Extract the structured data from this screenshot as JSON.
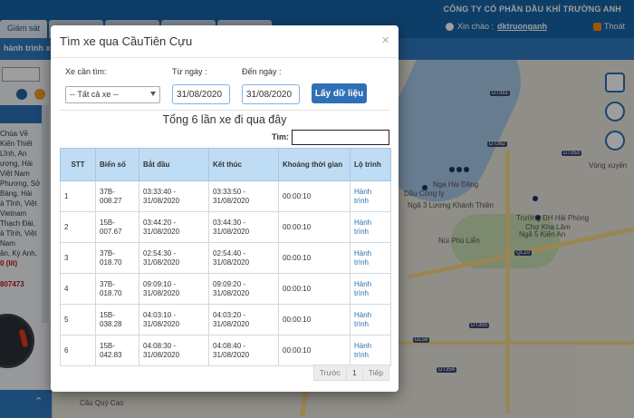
{
  "app": {
    "company": "CÔNG TY CỔ PHẦN DẦU KHÍ TRƯỜNG ANH",
    "greeting": "Xin chào :",
    "user": "dktruonganh",
    "logout_label": "Thoát",
    "tab_label": "Giám sát",
    "nav_label": "hành trình xe"
  },
  "sidebar": {
    "items": [
      "Chùa Về",
      "Kiến Thiết",
      "Lĩnh, An",
      "ương, Hải",
      "Việt Nam",
      "Phương, Sở",
      "Bàng, Hải",
      "à Tĩnh, Việt",
      "Vietnam",
      "Thạch Đài,",
      "à Tĩnh, Việt",
      "Nam",
      "ăn, Kỳ Anh,",
      "0 (lít)"
    ],
    "code": "807473"
  },
  "map": {
    "labels": [
      "Dầu Công ty",
      "Ngã 3 Lương Khánh Thiện",
      "Núi Phù Liễn",
      "Trường ĐH Hải Phòng",
      "Chợ Kha Lâm",
      "Ngã 5 Kiến An",
      "Nga Hài Đăng",
      "Vòng xuyến",
      "Cầu Quý Cao"
    ],
    "tags": [
      "DT351",
      "DT353",
      "DT354",
      "DT355",
      "DT362",
      "DL58",
      "QL10"
    ]
  },
  "modal": {
    "title": "Tìm xe qua CầuTiên Cựu",
    "close_label": "×",
    "vehicle_label": "Xe cần tìm:",
    "vehicle_value": "-- Tất cả xe --",
    "from_label": "Từ ngày :",
    "from_value": "31/08/2020",
    "to_label": "Đến ngày :",
    "to_value": "31/08/2020",
    "fetch_label": "Lấy dữ liệu",
    "summary": "Tổng 6 lần xe đi qua đây",
    "search_label": "Tìm:",
    "search_value": "",
    "columns": [
      "STT",
      "Biển số",
      "Bắt đầu",
      "Kết thúc",
      "Khoảng thời gian",
      "Lộ trình"
    ],
    "rows": [
      {
        "stt": "1",
        "plate": "37B-008.27",
        "start": "03:33:40 - 31/08/2020",
        "end": "03:33:50 - 31/08/2020",
        "duration": "00:00:10",
        "route": "Hành trình"
      },
      {
        "stt": "2",
        "plate": "15B-007.67",
        "start": "03:44:20 - 31/08/2020",
        "end": "03:44:30 - 31/08/2020",
        "duration": "00:00:10",
        "route": "Hành trình"
      },
      {
        "stt": "3",
        "plate": "37B-018.70",
        "start": "02:54:30 - 31/08/2020",
        "end": "02:54:40 - 31/08/2020",
        "duration": "00:00:10",
        "route": "Hành trình"
      },
      {
        "stt": "4",
        "plate": "37B-018.70",
        "start": "09:09:10 - 31/08/2020",
        "end": "09:09:20 - 31/08/2020",
        "duration": "00:00:10",
        "route": "Hành trình"
      },
      {
        "stt": "5",
        "plate": "15B-038.28",
        "start": "04:03:10 - 31/08/2020",
        "end": "04:03:20 - 31/08/2020",
        "duration": "00:00:10",
        "route": "Hành trình"
      },
      {
        "stt": "6",
        "plate": "15B-042.83",
        "start": "04:08:30 - 31/08/2020",
        "end": "04:08:40 - 31/08/2020",
        "duration": "00:00:10",
        "route": "Hành trình"
      }
    ],
    "pager": {
      "prev": "Trước",
      "page": "1",
      "next": "Tiếp"
    }
  }
}
